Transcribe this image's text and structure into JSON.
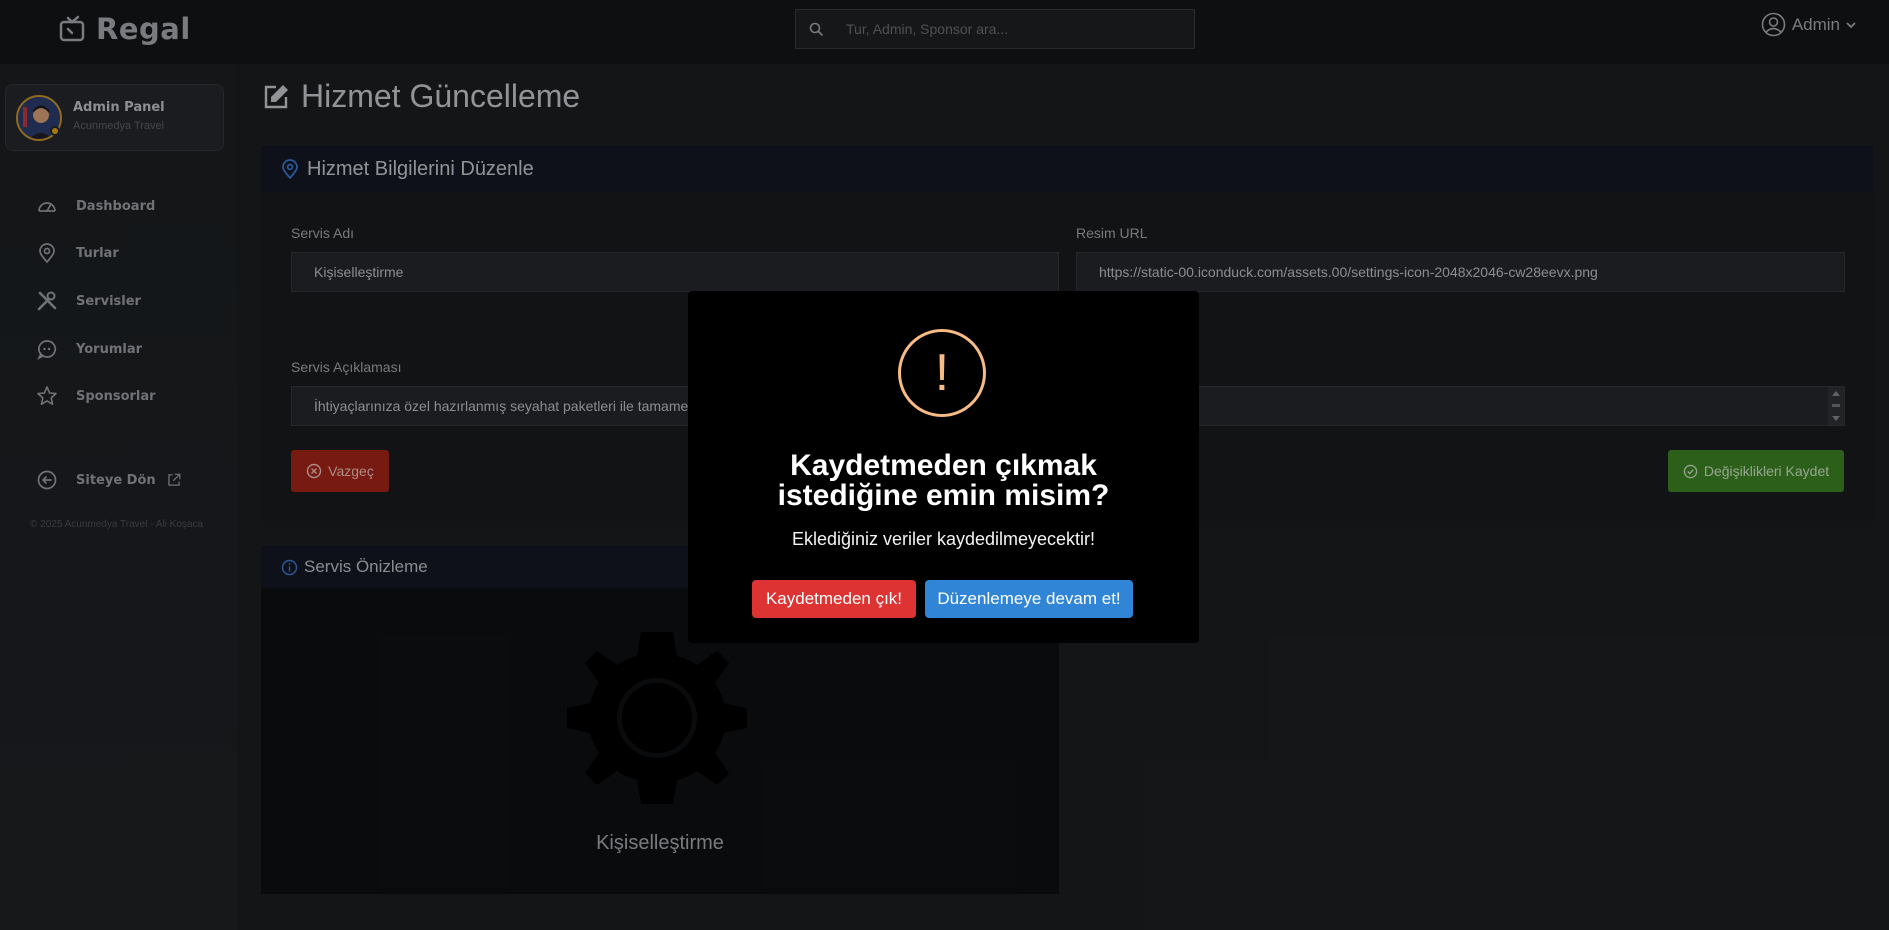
{
  "brand": {
    "name": "Regal"
  },
  "search": {
    "placeholder": "Tur, Admin, Sponsor ara..."
  },
  "user_menu": {
    "label": "Admin"
  },
  "sidebar": {
    "profile": {
      "name": "Admin Panel",
      "subtitle": "Acunmedya Travel"
    },
    "items": [
      {
        "label": "Dashboard",
        "icon": "dashboard-icon"
      },
      {
        "label": "Turlar",
        "icon": "map-pin-icon"
      },
      {
        "label": "Servisler",
        "icon": "tools-icon"
      },
      {
        "label": "Yorumlar",
        "icon": "comment-icon"
      },
      {
        "label": "Sponsorlar",
        "icon": "star-icon"
      },
      {
        "label": "Siteye Dön",
        "icon": "arrow-left-circle-icon"
      }
    ],
    "copyright": "© 2025 Acunmedya Travel - Ali Koşaca"
  },
  "main": {
    "page_title": "Hizmet Güncelleme",
    "form_card": {
      "title": "Hizmet Bilgilerini Düzenle",
      "name_label": "Servis Adı",
      "name_value": "Kişiselleştirme",
      "image_label": "Resim URL",
      "image_value": "https://static-00.iconduck.com/assets.00/settings-icon-2048x2046-cw28eevx.png",
      "desc_label": "Servis Açıklaması",
      "desc_value": "İhtiyaçlarınıza özel hazırlanmış seyahat paketleri ile tamamen size özel bir tatil deneyimi yaşayın.",
      "cancel_label": "Vazgeç",
      "save_label": "Değişiklikleri Kaydet"
    },
    "preview": {
      "title": "Servis Önizleme",
      "service_name": "Kişiselleştirme"
    }
  },
  "modal": {
    "icon": "!",
    "title_line1": "Kaydetmeden çıkmak",
    "title_line2": "istediğine emin misim?",
    "text": "Eklediğiniz veriler kaydedilmeyecektir!",
    "confirm_label": "Kaydetmeden çık!",
    "deny_label": "Düzenlemeye devam et!"
  },
  "colors": {
    "cancel": "#a52418",
    "save": "#3e8424",
    "warning": "#f8bb86",
    "modal_confirm": "#dd3333",
    "modal_deny": "#3085d6",
    "accent": "#3d7bd9"
  }
}
